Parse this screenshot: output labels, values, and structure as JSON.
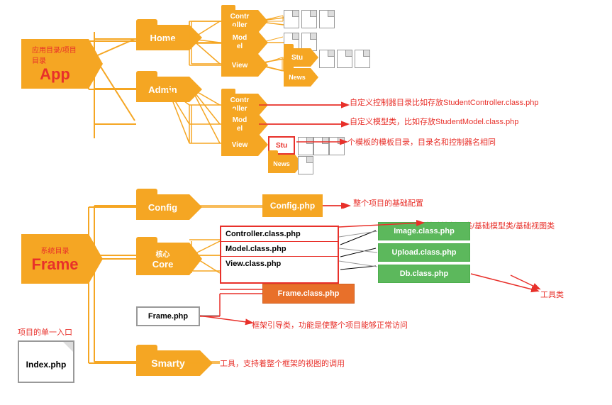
{
  "app_banner": {
    "subtitle": "应用目录/项目目录",
    "title": "App"
  },
  "frame_banner": {
    "subtitle": "系统目录",
    "title": "Frame"
  },
  "index_label": "项目的单一入口",
  "index_file": "Index.php",
  "folders": {
    "home": "Home",
    "admin": "Admin",
    "config": "Config",
    "core_label": "核心",
    "core": "Core",
    "smarty": "Smarty"
  },
  "sub_folders": {
    "controller": "Contr\noller",
    "model": "Mod\nel",
    "view": "View",
    "stu": "Stu",
    "news": "News"
  },
  "php_files": {
    "controller_class": "Controller.class.php",
    "model_class": "Model.class.php",
    "view_class": "View.class.php",
    "frame_class": "Frame.class.php",
    "config_php": "Config.php",
    "frame_php": "Frame.php",
    "image_class": "Image.class.php",
    "upload_class": "Upload.class.php",
    "db_class": "Db.class.php"
  },
  "annotations": {
    "custom_controller": "自定义控制器目录比如存放StudentController.class.php",
    "custom_model": "自定义模型类，比如存放StudentModel.class.php",
    "custom_view": "个模板的模板目录，目录名和控制器名相同",
    "config_desc": "整个项目的基础配置",
    "core_desc": "基础控制器类/基础模型类/基础视图类",
    "tool_desc": "工具类",
    "frame_desc": "框架引导类，功能是使整个项目能够正常访问",
    "smarty_desc": "工具，支持着整个框架的视图的调用"
  }
}
